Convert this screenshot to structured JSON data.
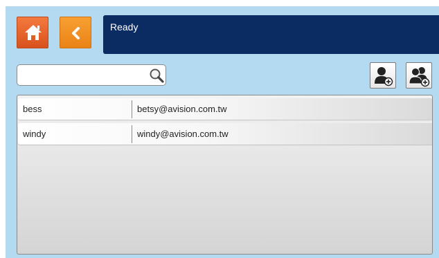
{
  "header": {
    "status": "Ready",
    "home_icon": "home-icon",
    "back_icon": "chevron-left-icon"
  },
  "search": {
    "value": "",
    "placeholder": "",
    "icon": "magnifier-icon"
  },
  "toolbar": {
    "add_user_icon": "add-user-icon",
    "add_group_icon": "add-group-icon"
  },
  "contacts": [
    {
      "name": "bess",
      "email": "betsy@avision.com.tw"
    },
    {
      "name": "windy",
      "email": "windy@avision.com.tw"
    }
  ],
  "colors": {
    "home_button": "#e0592a",
    "back_button": "#f39120",
    "status_bar": "#0b2c63",
    "background": "#b3daf0"
  }
}
